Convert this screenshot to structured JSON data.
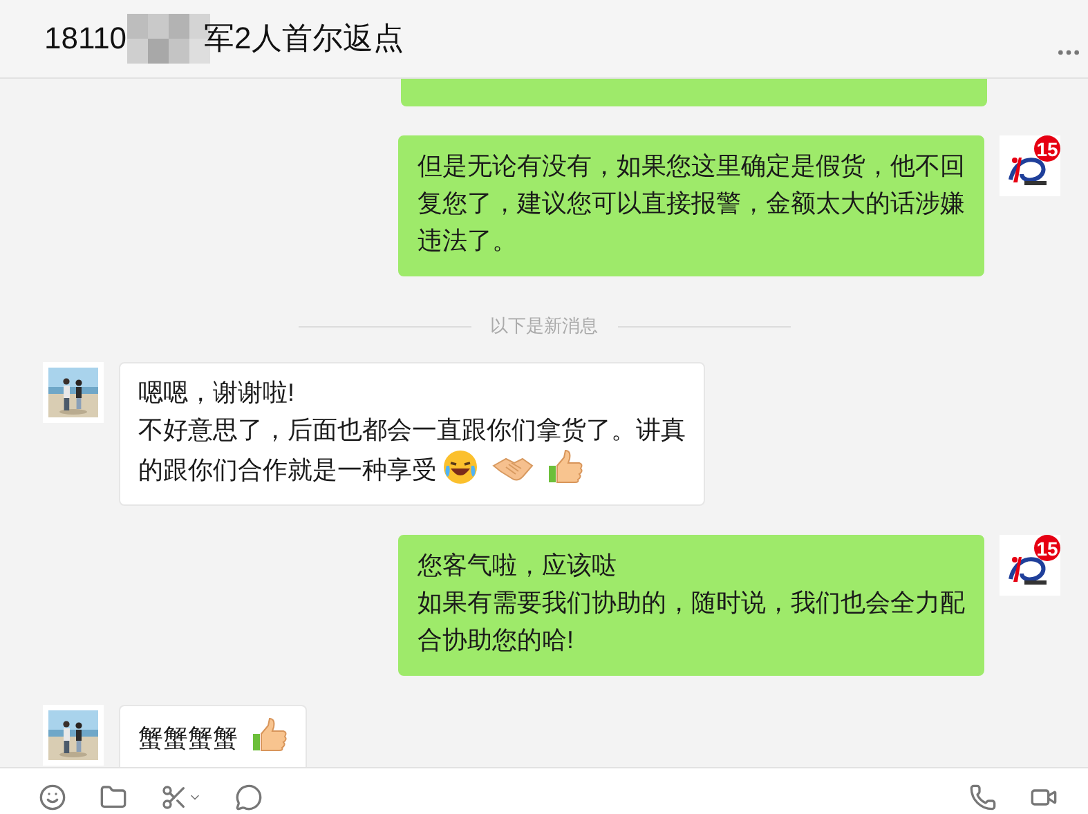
{
  "header": {
    "title_start": "18110",
    "title_end": "军2人首尔返点"
  },
  "messages": [
    {
      "kind": "cut_off"
    },
    {
      "kind": "sent",
      "paragraphs": [
        "但是无论有没有，如果您这里确定是假货，他不回复您了，建议您可以直接报警，金额太大的话涉嫌违法了。"
      ],
      "badge": "15"
    },
    {
      "kind": "divider",
      "label": "以下是新消息"
    },
    {
      "kind": "received",
      "paragraphs": [
        "嗯嗯，谢谢啦!",
        "不好意思了，后面也都会一直跟你们拿货了。讲真的跟你们合作就是一种享受"
      ],
      "emojis": [
        {
          "kind": "laughing"
        },
        {
          "kind": "handshake"
        },
        {
          "kind": "thumbs_up"
        }
      ]
    },
    {
      "kind": "sent",
      "paragraphs": [
        "您客气啦，应该哒",
        "如果有需要我们协助的，随时说，我们也会全力配合协助您的哈!"
      ],
      "badge": "15"
    },
    {
      "kind": "received",
      "paragraphs": [
        "蟹蟹蟹蟹"
      ],
      "emojis": [
        {
          "kind": "thumbs_up"
        }
      ]
    }
  ]
}
